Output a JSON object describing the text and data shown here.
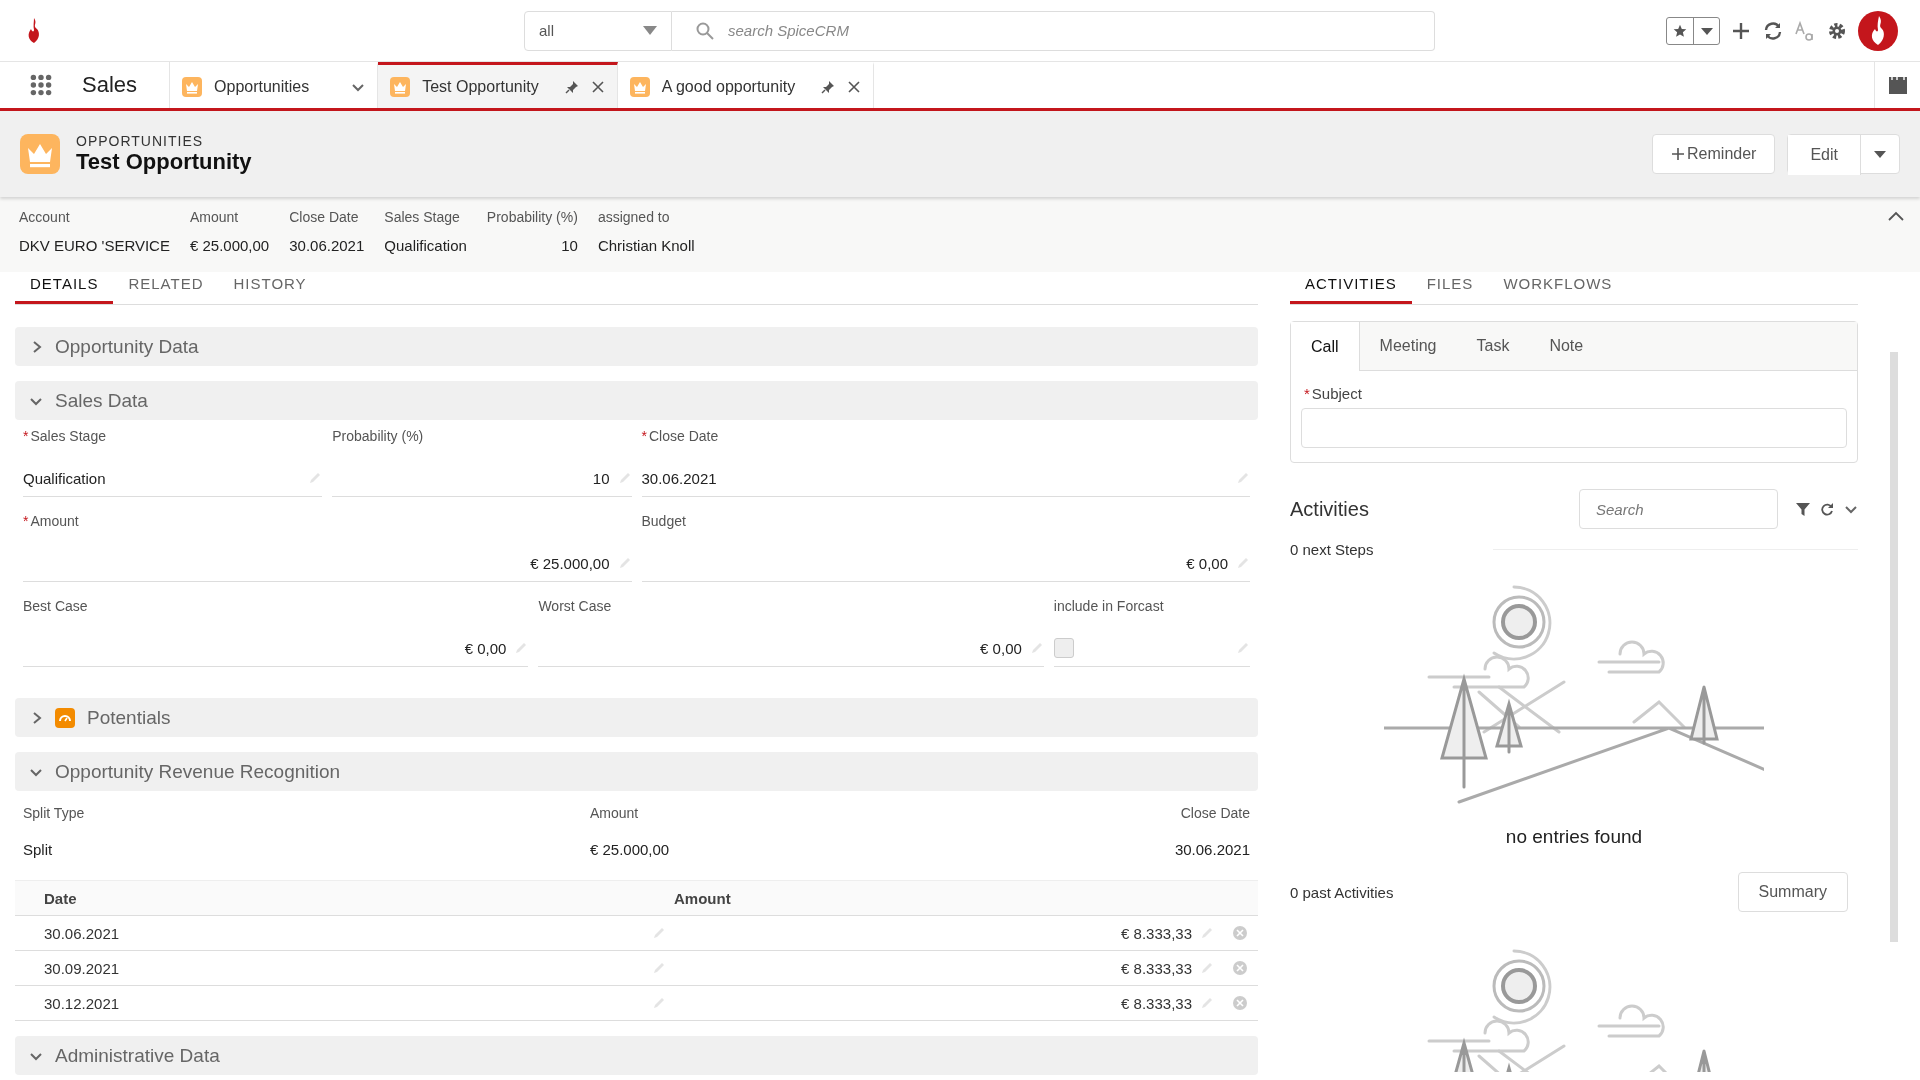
{
  "app": {
    "name": "Sales"
  },
  "required_mark": "*",
  "search": {
    "scope": "all",
    "placeholder": "search SpiceCRM"
  },
  "tabs": [
    {
      "label": "Opportunities",
      "kind": "module",
      "selected": false
    },
    {
      "label": "Test Opportunity",
      "kind": "record",
      "selected": true
    },
    {
      "label": "A good opportunity",
      "kind": "record",
      "selected": false
    }
  ],
  "header": {
    "module": "OPPORTUNITIES",
    "title": "Test Opportunity",
    "reminder_button": "Reminder",
    "edit_button": "Edit"
  },
  "summary": [
    {
      "label": "Account",
      "value": "DKV EURO 'SERVICE",
      "kind": "text"
    },
    {
      "label": "Amount",
      "value": "€ 25.000,00",
      "kind": "text"
    },
    {
      "label": "Close Date",
      "value": "30.06.2021",
      "kind": "text"
    },
    {
      "label": "Sales Stage",
      "value": "Qualification",
      "kind": "text"
    },
    {
      "label": "Probability (%)",
      "value": "10",
      "kind": "number"
    },
    {
      "label": "assigned to",
      "value": "Christian Knoll",
      "kind": "text"
    }
  ],
  "detail_tabs": [
    {
      "label": "DETAILS",
      "selected": true
    },
    {
      "label": "RELATED",
      "selected": false
    },
    {
      "label": "HISTORY",
      "selected": false
    }
  ],
  "sections": [
    {
      "kind": "plain",
      "title": "Opportunity Data",
      "expanded": false
    },
    {
      "kind": "fields",
      "title": "Sales Data",
      "expanded": true,
      "fields": [
        {
          "label": "Sales Stage",
          "value": "Qualification",
          "kind": "text",
          "required": true
        },
        {
          "label": "Probability (%)",
          "value": "10",
          "kind": "number",
          "required": false
        },
        {
          "label": "Close Date",
          "value": "30.06.2021",
          "kind": "text",
          "required": true
        },
        {
          "label": "Amount",
          "value": "€ 25.000,00",
          "kind": "number",
          "required": true
        },
        {
          "label": "Budget",
          "value": "€ 0,00",
          "kind": "number",
          "required": false
        },
        {
          "label": "Best Case",
          "value": "€ 0,00",
          "kind": "number",
          "required": false
        },
        {
          "label": "Worst Case",
          "value": "€ 0,00",
          "kind": "number",
          "required": false
        },
        {
          "label": "include in Forcast",
          "kind": "checkbox",
          "checked": false,
          "required": false
        }
      ]
    },
    {
      "kind": "icon",
      "title": "Potentials",
      "expanded": false
    },
    {
      "kind": "revenue",
      "title": "Opportunity Revenue Recognition",
      "expanded": true,
      "split_labels": [
        "Split Type",
        "Amount",
        "Close Date"
      ],
      "split_values": [
        "Split",
        "€ 25.000,00",
        "30.06.2021"
      ],
      "table": {
        "columns": [
          "Date",
          "Amount"
        ],
        "rows": [
          [
            "30.06.2021",
            "€ 8.333,33"
          ],
          [
            "30.09.2021",
            "€ 8.333,33"
          ],
          [
            "30.12.2021",
            "€ 8.333,33"
          ]
        ]
      }
    },
    {
      "kind": "plain",
      "title": "Administrative Data",
      "expanded": true
    }
  ],
  "activity_tabs": [
    {
      "label": "ACTIVITIES",
      "selected": true
    },
    {
      "label": "FILES",
      "selected": false
    },
    {
      "label": "WORKFLOWS",
      "selected": false
    }
  ],
  "composer": {
    "tabs": [
      {
        "label": "Call",
        "selected": true
      },
      {
        "label": "Meeting",
        "selected": false
      },
      {
        "label": "Task",
        "selected": false
      },
      {
        "label": "Note",
        "selected": false
      }
    ],
    "subject_label": "Subject",
    "subject_required": true
  },
  "activities": {
    "title": "Activities",
    "search_placeholder": "Search",
    "next_steps": "0 next Steps",
    "empty_text": "no entries found",
    "past": "0 past Activities",
    "summary_button": "Summary"
  }
}
